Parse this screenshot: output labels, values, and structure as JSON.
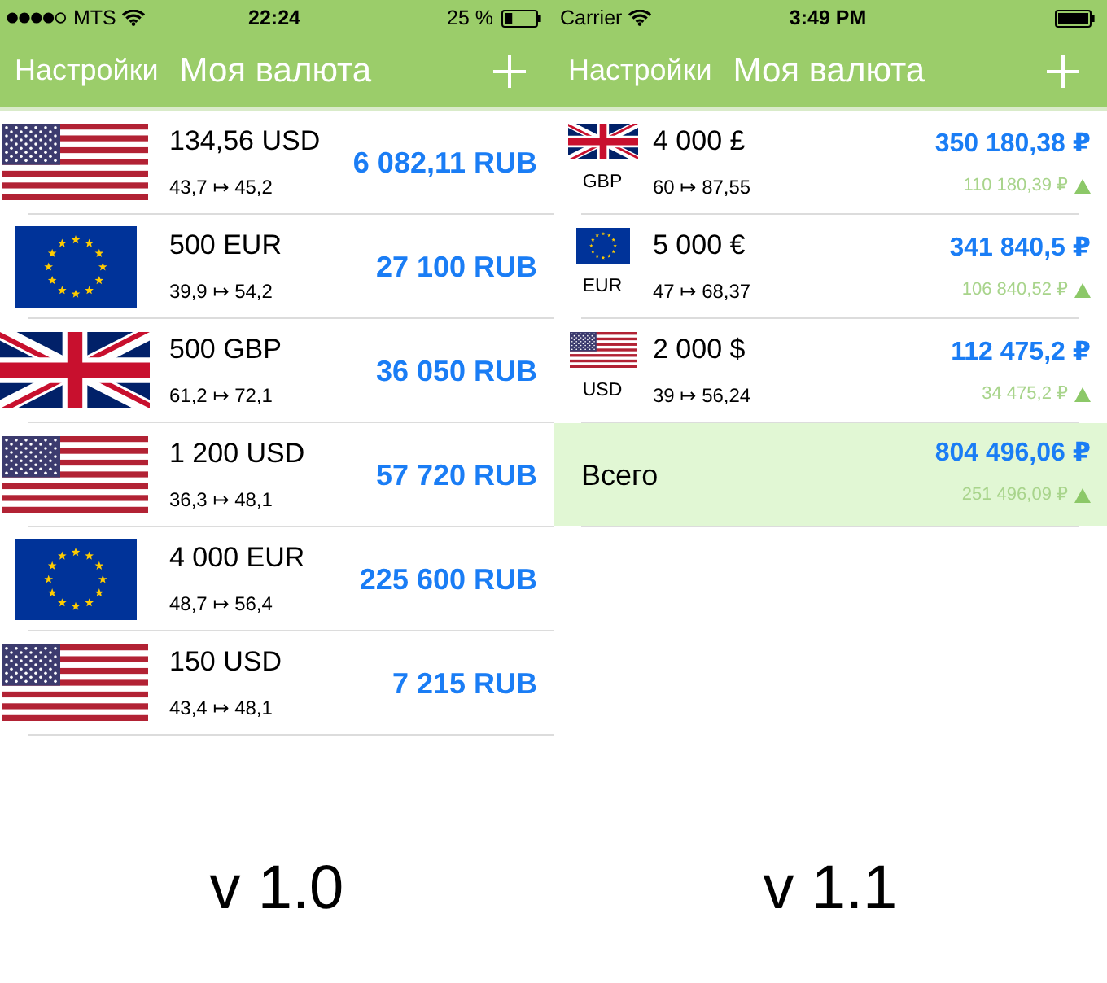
{
  "panels": [
    {
      "kind": "large_flags",
      "status_bar": {
        "signal": true,
        "carrier": "MTS",
        "time": "22:24",
        "battery_text": "25 %",
        "battery_low": true
      },
      "nav_bar": {
        "back": "Настройки",
        "title": "Моя валюта"
      },
      "rows": [
        {
          "flag": {
            "kind": "us"
          },
          "amount": "134,56 USD",
          "rates": "43,7 ↦ 45,2",
          "value": "6 082,11 RUB"
        },
        {
          "flag": {
            "kind": "eu"
          },
          "amount": "500 EUR",
          "rates": "39,9 ↦ 54,2",
          "value": "27 100 RUB"
        },
        {
          "flag": {
            "kind": "gb"
          },
          "amount": "500 GBP",
          "rates": "61,2 ↦ 72,1",
          "value": "36 050 RUB"
        },
        {
          "flag": {
            "kind": "us"
          },
          "amount": "1 200 USD",
          "rates": "36,3 ↦ 48,1",
          "value": "57 720 RUB"
        },
        {
          "flag": {
            "kind": "eu"
          },
          "amount": "4 000 EUR",
          "rates": "48,7 ↦ 56,4",
          "value": "225 600 RUB"
        },
        {
          "flag": {
            "kind": "us"
          },
          "amount": "150 USD",
          "rates": "43,4 ↦ 48,1",
          "value": "7 215 RUB"
        }
      ],
      "caption": "v 1.0"
    },
    {
      "kind": "small_flags",
      "status_bar": {
        "carrier": "Carrier",
        "time": "3:49 PM",
        "battery_low": false
      },
      "nav_bar": {
        "back": "Настройки",
        "title": "Моя валюта"
      },
      "rows": [
        {
          "flag": {
            "kind": "gb"
          },
          "code": "GBP",
          "amount": "4 000 £",
          "rates": "60 ↦ 87,55",
          "value": "350 180,38 ₽",
          "change": "110 180,39 ₽",
          "rising": true
        },
        {
          "flag": {
            "kind": "eu"
          },
          "code": "EUR",
          "amount": "5 000 €",
          "rates": "47 ↦ 68,37",
          "value": "341 840,5 ₽",
          "change": "106 840,52 ₽",
          "rising": true
        },
        {
          "flag": {
            "kind": "us"
          },
          "code": "USD",
          "amount": "2 000 $",
          "rates": "39 ↦ 56,24",
          "value": "112 475,2 ₽",
          "change": "34 475,2 ₽",
          "rising": true
        }
      ],
      "total": {
        "label": "Всего",
        "value": "804 496,06 ₽",
        "change": "251 496,09 ₽",
        "rising": true
      },
      "caption": "v 1.1"
    }
  ]
}
